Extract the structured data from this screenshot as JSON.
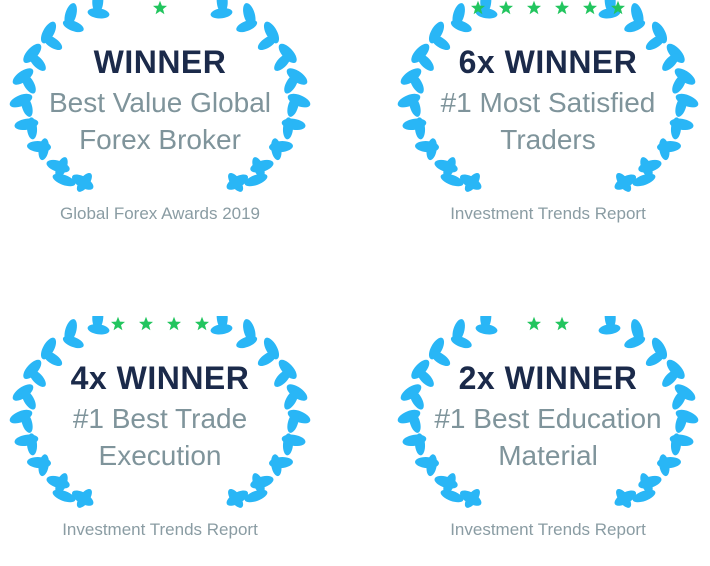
{
  "colors": {
    "accent": "#29b6f6",
    "star": "#22c55e",
    "title": "#1b2a4a",
    "text": "#7f949b"
  },
  "awards": [
    {
      "stars": 1,
      "title": "WINNER",
      "line1": "Best Value Global",
      "line2": "Forex Broker",
      "source": "Global Forex Awards 2019"
    },
    {
      "stars": 6,
      "title": "6x WINNER",
      "line1": "#1 Most Satisfied",
      "line2": "Traders",
      "source": "Investment Trends Report"
    },
    {
      "stars": 4,
      "title": "4x WINNER",
      "line1": "#1 Best Trade",
      "line2": "Execution",
      "source": "Investment Trends Report"
    },
    {
      "stars": 2,
      "title": "2x WINNER",
      "line1": "#1 Best Education",
      "line2": "Material",
      "source": "Investment Trends Report"
    }
  ]
}
